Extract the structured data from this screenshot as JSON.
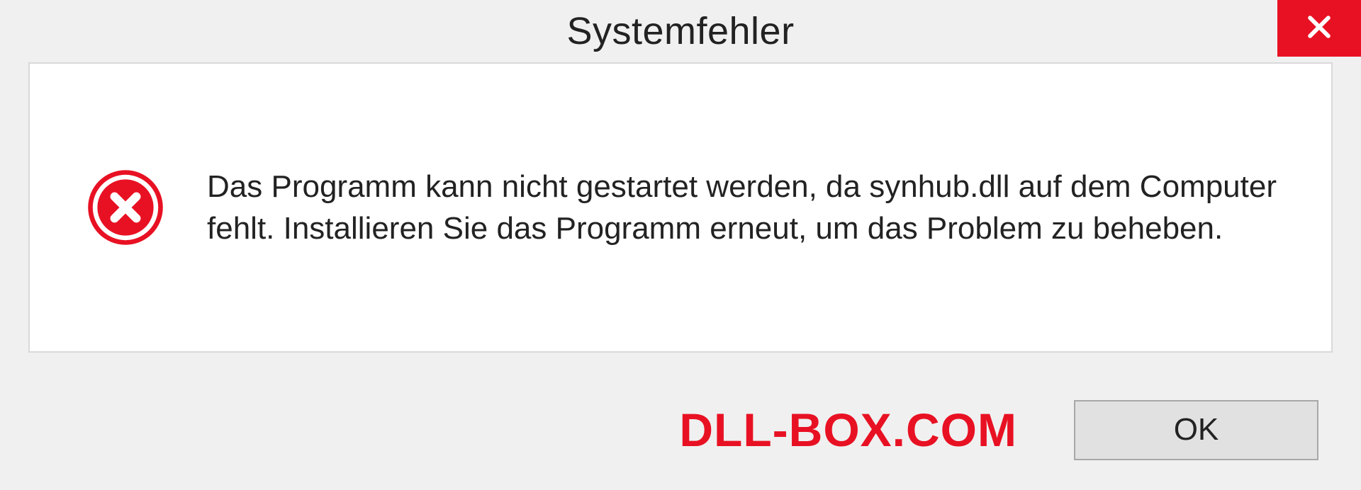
{
  "dialog": {
    "title": "Systemfehler",
    "message": "Das Programm kann nicht gestartet werden, da synhub.dll auf dem Computer fehlt. Installieren Sie das Programm erneut, um das Problem zu beheben.",
    "ok_label": "OK"
  },
  "watermark": "DLL-BOX.COM",
  "colors": {
    "error_red": "#e81123",
    "bg": "#f0f0f0",
    "panel": "#ffffff",
    "border": "#d9d9d9",
    "button_bg": "#e1e1e1"
  }
}
